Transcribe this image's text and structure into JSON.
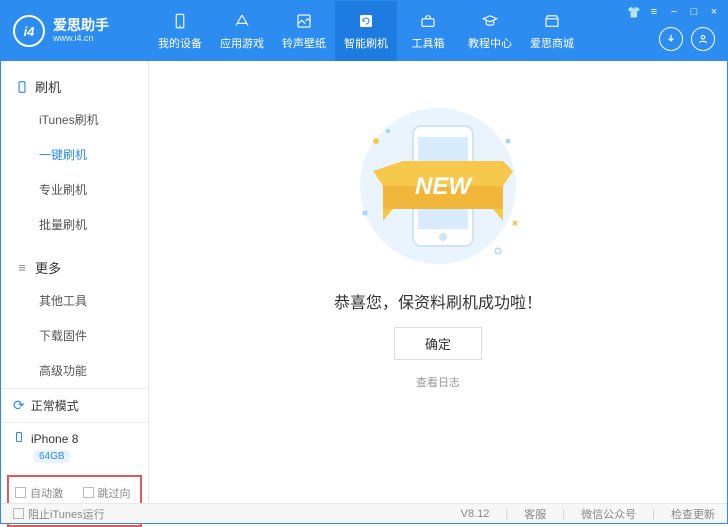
{
  "header": {
    "logo_cn": "爱思助手",
    "logo_url": "www.i4.cn",
    "nav": [
      {
        "label": "我的设备"
      },
      {
        "label": "应用游戏"
      },
      {
        "label": "铃声壁纸"
      },
      {
        "label": "智能刷机",
        "active": true
      },
      {
        "label": "工具箱"
      },
      {
        "label": "教程中心"
      },
      {
        "label": "爱思商城"
      }
    ]
  },
  "sidebar": {
    "sections": [
      {
        "title": "刷机",
        "items": [
          {
            "label": "iTunes刷机"
          },
          {
            "label": "一键刷机",
            "active": true
          },
          {
            "label": "专业刷机"
          },
          {
            "label": "批量刷机"
          }
        ]
      },
      {
        "title": "更多",
        "items": [
          {
            "label": "其他工具"
          },
          {
            "label": "下载固件"
          },
          {
            "label": "高级功能"
          }
        ]
      }
    ],
    "mode": "正常模式",
    "device": {
      "name": "iPhone 8",
      "storage": "64GB"
    },
    "options": {
      "auto_activate": "自动激活",
      "skip_guide": "跳过向导"
    }
  },
  "main": {
    "banner_text": "NEW",
    "success": "恭喜您，保资料刷机成功啦！",
    "ok_label": "确定",
    "log_link": "查看日志"
  },
  "footer": {
    "block_itunes": "阻止iTunes运行",
    "version": "V8.12",
    "support": "客服",
    "wechat": "微信公众号",
    "update": "检查更新"
  }
}
